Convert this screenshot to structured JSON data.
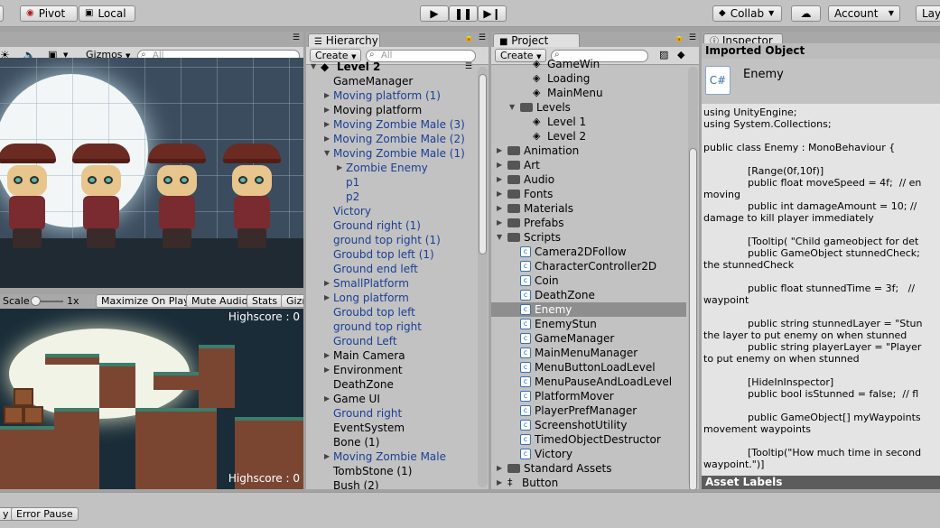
{
  "toolbar": {
    "pivot": "Pivot",
    "local": "Local",
    "collab": "Collab",
    "account": "Account",
    "layers": "Lay"
  },
  "scene": {
    "gizmos": "Gizmos",
    "search_placeholder": "All"
  },
  "game": {
    "scale_label": "Scale",
    "scale_value": "1x",
    "maximize": "Maximize On Play",
    "mute": "Mute Audio",
    "stats": "Stats",
    "gizmos": "Gizm",
    "highscore_top": "Highscore : 0",
    "highscore_bottom": "Highscore : 0"
  },
  "hierarchy": {
    "tab": "Hierarchy",
    "create": "Create",
    "search_placeholder": "All",
    "scene_name": "Level 2",
    "items": [
      {
        "label": "GameManager",
        "type": "normal",
        "indent": 0,
        "arrow": ""
      },
      {
        "label": "Moving platform (1)",
        "type": "prefab",
        "indent": 0,
        "arrow": "right"
      },
      {
        "label": "Moving platform",
        "type": "normal",
        "indent": 0,
        "arrow": "right"
      },
      {
        "label": "Moving Zombie Male (3)",
        "type": "prefab",
        "indent": 0,
        "arrow": "right"
      },
      {
        "label": "Moving Zombie Male (2)",
        "type": "prefab",
        "indent": 0,
        "arrow": "right"
      },
      {
        "label": "Moving Zombie Male (1)",
        "type": "prefab",
        "indent": 0,
        "arrow": "down"
      },
      {
        "label": "Zombie Enemy",
        "type": "prefab",
        "indent": 1,
        "arrow": "right"
      },
      {
        "label": "p1",
        "type": "prefab",
        "indent": 1,
        "arrow": ""
      },
      {
        "label": "p2",
        "type": "prefab",
        "indent": 1,
        "arrow": ""
      },
      {
        "label": "Victory",
        "type": "prefab",
        "indent": 0,
        "arrow": ""
      },
      {
        "label": "Ground right (1)",
        "type": "prefab",
        "indent": 0,
        "arrow": ""
      },
      {
        "label": "ground top right (1)",
        "type": "prefab",
        "indent": 0,
        "arrow": ""
      },
      {
        "label": "Groubd top left (1)",
        "type": "prefab",
        "indent": 0,
        "arrow": ""
      },
      {
        "label": "Ground end left",
        "type": "prefab",
        "indent": 0,
        "arrow": ""
      },
      {
        "label": "SmallPlatform",
        "type": "prefab",
        "indent": 0,
        "arrow": "right"
      },
      {
        "label": "Long platform",
        "type": "prefab",
        "indent": 0,
        "arrow": "right"
      },
      {
        "label": "Groubd top left",
        "type": "prefab",
        "indent": 0,
        "arrow": ""
      },
      {
        "label": "ground top right",
        "type": "prefab",
        "indent": 0,
        "arrow": ""
      },
      {
        "label": "Ground Left",
        "type": "prefab",
        "indent": 0,
        "arrow": ""
      },
      {
        "label": "Main Camera",
        "type": "normal",
        "indent": 0,
        "arrow": "right"
      },
      {
        "label": "Environment",
        "type": "normal",
        "indent": 0,
        "arrow": "right"
      },
      {
        "label": "DeathZone",
        "type": "normal",
        "indent": 0,
        "arrow": ""
      },
      {
        "label": "Game UI",
        "type": "normal",
        "indent": 0,
        "arrow": "right"
      },
      {
        "label": "Ground right",
        "type": "prefab",
        "indent": 0,
        "arrow": ""
      },
      {
        "label": "EventSystem",
        "type": "normal",
        "indent": 0,
        "arrow": ""
      },
      {
        "label": "Bone (1)",
        "type": "normal",
        "indent": 0,
        "arrow": ""
      },
      {
        "label": "Moving Zombie Male",
        "type": "prefab",
        "indent": 0,
        "arrow": "right"
      },
      {
        "label": "TombStone (1)",
        "type": "normal",
        "indent": 0,
        "arrow": ""
      },
      {
        "label": "Bush (2)",
        "type": "normal",
        "indent": 0,
        "arrow": ""
      }
    ]
  },
  "project": {
    "tab": "Project",
    "create": "Create",
    "items": [
      {
        "label": "GameWin",
        "icon": "unity",
        "indent": 2,
        "arrow": "",
        "selected": false
      },
      {
        "label": "Loading",
        "icon": "unity",
        "indent": 2,
        "arrow": "",
        "selected": false
      },
      {
        "label": "MainMenu",
        "icon": "unity",
        "indent": 2,
        "arrow": "",
        "selected": false
      },
      {
        "label": "Levels",
        "icon": "folder",
        "indent": 1,
        "arrow": "down",
        "selected": false
      },
      {
        "label": "Level 1",
        "icon": "unity",
        "indent": 2,
        "arrow": "",
        "selected": false
      },
      {
        "label": "Level 2",
        "icon": "unity",
        "indent": 2,
        "arrow": "",
        "selected": false
      },
      {
        "label": "Animation",
        "icon": "folder",
        "indent": 0,
        "arrow": "right",
        "selected": false
      },
      {
        "label": "Art",
        "icon": "folder",
        "indent": 0,
        "arrow": "right",
        "selected": false
      },
      {
        "label": "Audio",
        "icon": "folder",
        "indent": 0,
        "arrow": "right",
        "selected": false
      },
      {
        "label": "Fonts",
        "icon": "folder",
        "indent": 0,
        "arrow": "right",
        "selected": false
      },
      {
        "label": "Materials",
        "icon": "folder",
        "indent": 0,
        "arrow": "right",
        "selected": false
      },
      {
        "label": "Prefabs",
        "icon": "folder",
        "indent": 0,
        "arrow": "right",
        "selected": false
      },
      {
        "label": "Scripts",
        "icon": "folder",
        "indent": 0,
        "arrow": "down",
        "selected": false
      },
      {
        "label": "Camera2DFollow",
        "icon": "cs",
        "indent": 1,
        "arrow": "",
        "selected": false
      },
      {
        "label": "CharacterController2D",
        "icon": "cs",
        "indent": 1,
        "arrow": "",
        "selected": false
      },
      {
        "label": "Coin",
        "icon": "cs",
        "indent": 1,
        "arrow": "",
        "selected": false
      },
      {
        "label": "DeathZone",
        "icon": "cs",
        "indent": 1,
        "arrow": "",
        "selected": false
      },
      {
        "label": "Enemy",
        "icon": "cs",
        "indent": 1,
        "arrow": "",
        "selected": true
      },
      {
        "label": "EnemyStun",
        "icon": "cs",
        "indent": 1,
        "arrow": "",
        "selected": false
      },
      {
        "label": "GameManager",
        "icon": "cs",
        "indent": 1,
        "arrow": "",
        "selected": false
      },
      {
        "label": "MainMenuManager",
        "icon": "cs",
        "indent": 1,
        "arrow": "",
        "selected": false
      },
      {
        "label": "MenuButtonLoadLevel",
        "icon": "cs",
        "indent": 1,
        "arrow": "",
        "selected": false
      },
      {
        "label": "MenuPauseAndLoadLevel",
        "icon": "cs",
        "indent": 1,
        "arrow": "",
        "selected": false
      },
      {
        "label": "PlatformMover",
        "icon": "cs",
        "indent": 1,
        "arrow": "",
        "selected": false
      },
      {
        "label": "PlayerPrefManager",
        "icon": "cs",
        "indent": 1,
        "arrow": "",
        "selected": false
      },
      {
        "label": "ScreenshotUtility",
        "icon": "cs",
        "indent": 1,
        "arrow": "",
        "selected": false
      },
      {
        "label": "TimedObjectDestructor",
        "icon": "cs",
        "indent": 1,
        "arrow": "",
        "selected": false
      },
      {
        "label": "Victory",
        "icon": "cs",
        "indent": 1,
        "arrow": "",
        "selected": false
      },
      {
        "label": "Standard Assets",
        "icon": "folder",
        "indent": 0,
        "arrow": "right",
        "selected": false
      },
      {
        "label": "Button",
        "icon": "font",
        "indent": 0,
        "arrow": "right",
        "selected": false
      }
    ]
  },
  "inspector": {
    "tab": "Inspector",
    "header": "Imported Object",
    "object_name": "Enemy",
    "code": "using UnityEngine;\nusing System.Collections;\n\npublic class Enemy : MonoBehaviour {\n\n              [Range(0f,10f)]\n              public float moveSpeed = 4f;  // en\nmoving\n              public int damageAmount = 10; //\ndamage to kill player immediately\n\n              [Tooltip( \"Child gameobject for det\n              public GameObject stunnedCheck;\nthe stunnedCheck\n\n              public float stunnedTime = 3f;   //\nwaypoint\n\n              public string stunnedLayer = \"Stun\nthe layer to put enemy on when stunned\n              public string playerLayer = \"Player\nto put enemy on when stunned\n\n              [HideInInspector]\n              public bool isStunned = false;  // fl\n\n              public GameObject[] myWaypoints\nmovement waypoints\n\n              [Tooltip(\"How much time in second\nwaypoint.\")]",
    "asset_labels": "Asset Labels"
  },
  "bottom": {
    "first": "y",
    "error_pause": "Error Pause"
  }
}
